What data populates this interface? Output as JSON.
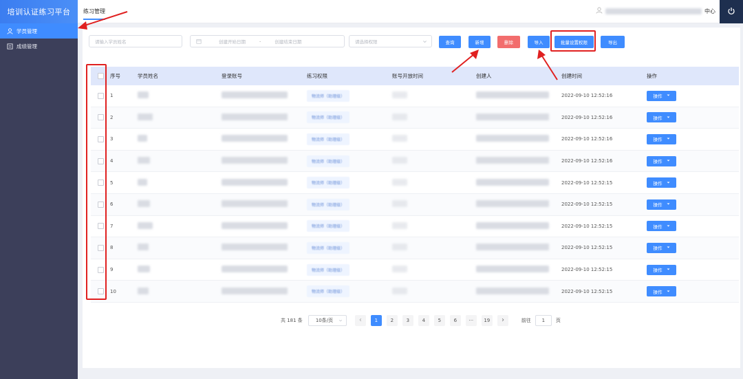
{
  "app": {
    "title": "培训认证练习平台"
  },
  "sidebar": {
    "items": [
      {
        "label": "学员管理",
        "icon": "user-icon",
        "active": true
      },
      {
        "label": "成绩管理",
        "icon": "report-icon",
        "active": false
      }
    ]
  },
  "header": {
    "tab": "练习管理",
    "user_suffix": "中心",
    "power_icon": "power-icon"
  },
  "filters": {
    "name_placeholder": "请输入学员姓名",
    "start_date_placeholder": "创建开始日期",
    "date_separator": "-",
    "end_date_placeholder": "创建结束日期",
    "permission_placeholder": "请选择权限"
  },
  "toolbar": {
    "query": "查询",
    "add": "新增",
    "delete": "删除",
    "import": "导入",
    "batch_perm": "批量设置权限",
    "export": "导出"
  },
  "table": {
    "columns": [
      "序号",
      "学员姓名",
      "登录账号",
      "练习权限",
      "账号开放时间",
      "创建人",
      "创建时间",
      "操作"
    ],
    "rows": [
      {
        "index": "1",
        "permission": "物流师（助理级）",
        "created": "2022-09-10 12:52:16",
        "action": "操作"
      },
      {
        "index": "2",
        "permission": "物流师（助理级）",
        "created": "2022-09-10 12:52:16",
        "action": "操作"
      },
      {
        "index": "3",
        "permission": "物流师（助理级）",
        "created": "2022-09-10 12:52:16",
        "action": "操作"
      },
      {
        "index": "4",
        "permission": "物流师（助理级）",
        "created": "2022-09-10 12:52:16",
        "action": "操作"
      },
      {
        "index": "5",
        "permission": "物流师（助理级）",
        "created": "2022-09-10 12:52:15",
        "action": "操作"
      },
      {
        "index": "6",
        "permission": "物流师（助理级）",
        "created": "2022-09-10 12:52:15",
        "action": "操作"
      },
      {
        "index": "7",
        "permission": "物流师（助理级）",
        "created": "2022-09-10 12:52:15",
        "action": "操作"
      },
      {
        "index": "8",
        "permission": "物流师（助理级）",
        "created": "2022-09-10 12:52:15",
        "action": "操作"
      },
      {
        "index": "9",
        "permission": "物流师（助理级）",
        "created": "2022-09-10 12:52:15",
        "action": "操作"
      },
      {
        "index": "10",
        "permission": "物流师（助理级）",
        "created": "2022-09-10 12:52:15",
        "action": "操作"
      }
    ]
  },
  "pagination": {
    "total": "共 181 条",
    "page_size": "10条/页",
    "pages": [
      "1",
      "2",
      "3",
      "4",
      "5",
      "6",
      "···",
      "19"
    ],
    "current": "1",
    "goto_label": "前往",
    "goto_value": "1",
    "page_unit": "页"
  },
  "colors": {
    "accent": "#3f8cff",
    "sidebar_bg": "#3c3f5a",
    "danger": "#f26d6d",
    "annotation": "#e02020"
  }
}
